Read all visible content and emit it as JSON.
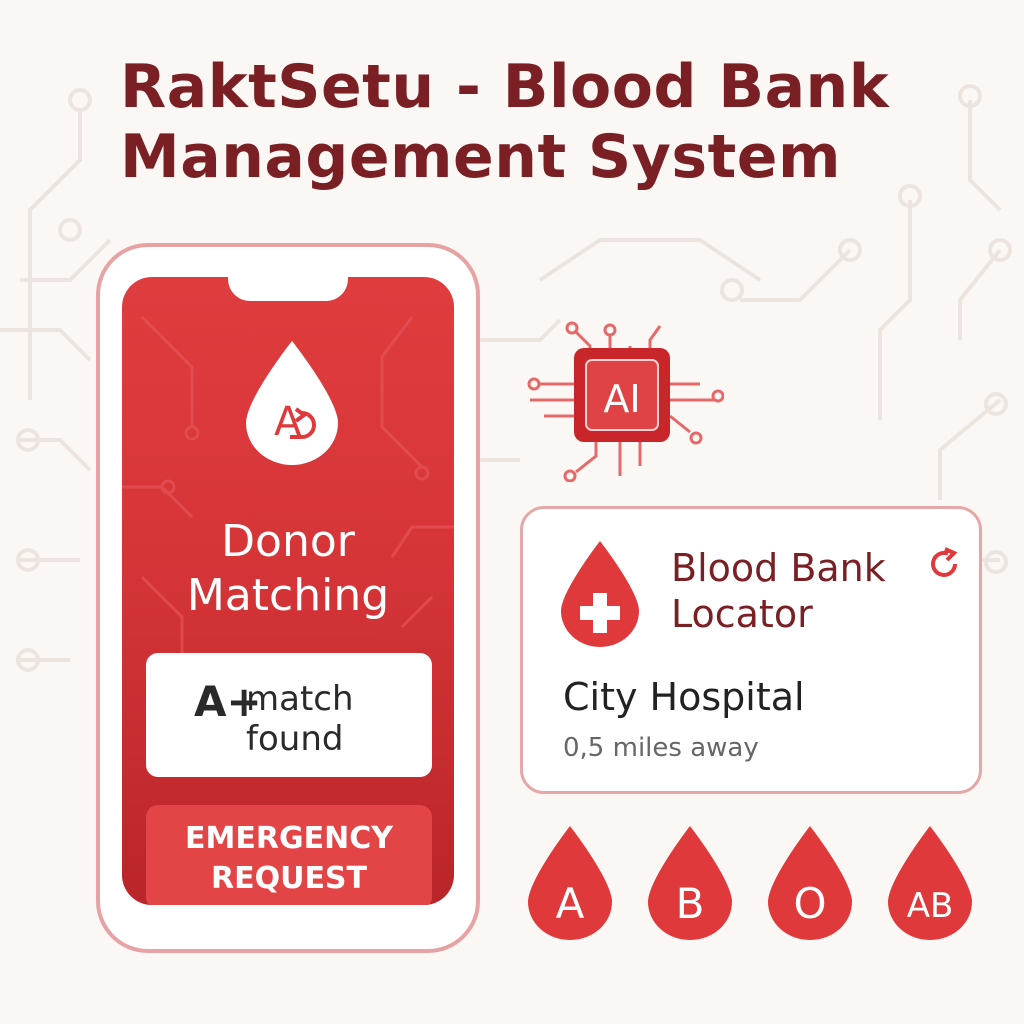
{
  "title": {
    "line1": "RaktSetu - Blood Bank",
    "line2": "Management System"
  },
  "phone": {
    "feature_title_line1": "Donor",
    "feature_title_line2": "Matching",
    "match_card": {
      "blood_type": "A+",
      "text_line1": "match",
      "text_line2": "found"
    },
    "emergency_button": {
      "line1": "EMERGENCY",
      "line2": "REQUEST"
    }
  },
  "ai_chip": {
    "label": "AI"
  },
  "locator": {
    "title_line1": "Blood Bank",
    "title_line2": "Locator",
    "hospital": "City Hospital",
    "distance": "0,5 miles away"
  },
  "blood_types": [
    "A",
    "B",
    "O",
    "AB"
  ],
  "icons": {
    "donor_drop": "blood-drop-a-icon",
    "locator_drop": "blood-drop-plus-icon",
    "refresh": "refresh-icon",
    "chip": "ai-chip-icon"
  },
  "colors": {
    "brand_dark": "#7a1f24",
    "primary_red": "#e0393b",
    "light_border": "#e5a8a8",
    "background": "#faf7f4"
  }
}
